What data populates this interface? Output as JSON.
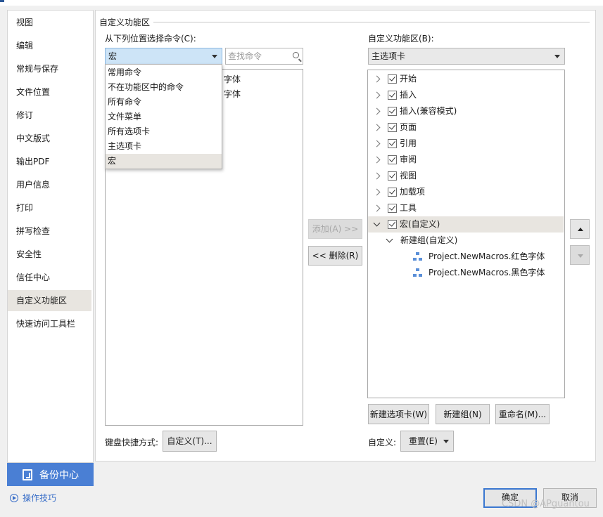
{
  "sidebar": {
    "items": [
      {
        "label": "视图"
      },
      {
        "label": "编辑"
      },
      {
        "label": "常规与保存"
      },
      {
        "label": "文件位置"
      },
      {
        "label": "修订"
      },
      {
        "label": "中文版式"
      },
      {
        "label": "输出PDF"
      },
      {
        "label": "用户信息"
      },
      {
        "label": "打印"
      },
      {
        "label": "拼写检查"
      },
      {
        "label": "安全性"
      },
      {
        "label": "信任中心"
      },
      {
        "label": "自定义功能区"
      },
      {
        "label": "快速访问工具栏"
      }
    ],
    "selected_index": 12,
    "backup_label": "备份中心",
    "tips_label": "操作技巧"
  },
  "main": {
    "section_title": "自定义功能区",
    "left": {
      "choose_label": "从下列位置选择命令(C):",
      "combo_value": "宏",
      "search_placeholder": "查找命令",
      "dropdown_options": [
        "常用命令",
        "不在功能区中的命令",
        "所有命令",
        "文件菜单",
        "所有选项卡",
        "主选项卡",
        "宏"
      ],
      "dropdown_selected_index": 6,
      "list_peek": [
        "字体",
        "字体"
      ],
      "shortcut_label": "键盘快捷方式:",
      "customize_btn": "自定义(T)..."
    },
    "middle": {
      "add_btn": "添加(A) >>",
      "remove_btn": "<< 删除(R)"
    },
    "right": {
      "ribbon_label": "自定义功能区(B):",
      "combo_value": "主选项卡",
      "tabs": [
        {
          "label": "开始",
          "checked": true
        },
        {
          "label": "插入",
          "checked": true
        },
        {
          "label": "插入(兼容模式)",
          "checked": true
        },
        {
          "label": "页面",
          "checked": true
        },
        {
          "label": "引用",
          "checked": true
        },
        {
          "label": "审阅",
          "checked": true
        },
        {
          "label": "视图",
          "checked": true
        },
        {
          "label": "加载项",
          "checked": true
        },
        {
          "label": "工具",
          "checked": true
        },
        {
          "label": "宏(自定义)",
          "checked": true
        }
      ],
      "group_label": "新建组(自定义)",
      "macros": [
        "Project.NewMacros.红色字体",
        "Project.NewMacros.黑色字体"
      ],
      "new_tab_btn": "新建选项卡(W)",
      "new_group_btn": "新建组(N)",
      "rename_btn": "重命名(M)...",
      "customize_label": "自定义:",
      "reset_btn": "重置(E)"
    }
  },
  "footer": {
    "ok": "确定",
    "cancel": "取消",
    "watermark": "CSDN @APguantou"
  },
  "colors": {
    "accent": "#4a7fd4",
    "selected_bg": "#e8e5e0",
    "combo_active": "#cde4f7"
  }
}
